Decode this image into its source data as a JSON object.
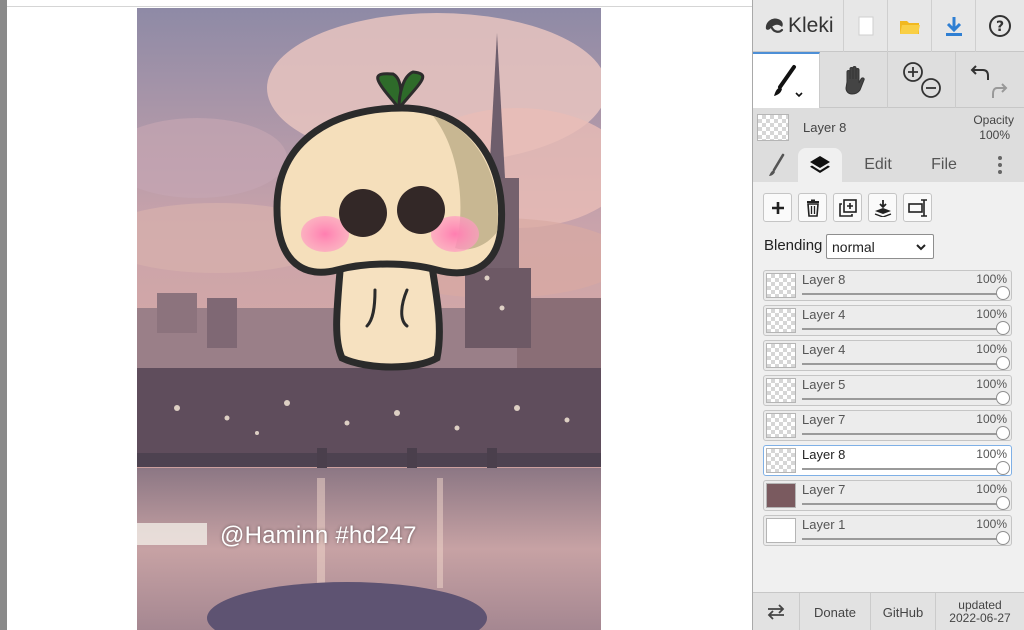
{
  "app": {
    "name": "Kleki",
    "accent": "#4d8fd6"
  },
  "canvas": {
    "watermark": "@Haminn  #hd247"
  },
  "topbar": {
    "buttons": [
      "new-image-icon",
      "open-folder-icon",
      "download-icon",
      "help-icon"
    ]
  },
  "tools": {
    "active": "brush",
    "items": [
      "brush-icon",
      "hand-icon",
      "zoom-in-icon",
      "zoom-out-icon",
      "undo-icon",
      "redo-icon"
    ]
  },
  "current_layer": {
    "name": "Layer 8",
    "opacity_label": "Opacity",
    "opacity_value": "100%"
  },
  "tabs": {
    "edit": "Edit",
    "file": "File",
    "active": "layers"
  },
  "layer_actions": [
    "add-layer",
    "delete-layer",
    "duplicate-layer",
    "merge-down",
    "rename-layer"
  ],
  "blending": {
    "label": "Blending",
    "value": "normal"
  },
  "layers": [
    {
      "name": "Layer 8",
      "opacity": "100%",
      "level": 1.0,
      "selected": false
    },
    {
      "name": "Layer 4",
      "opacity": "100%",
      "level": 1.0,
      "selected": false
    },
    {
      "name": "Layer 4",
      "opacity": "100%",
      "level": 1.0,
      "selected": false
    },
    {
      "name": "Layer 5",
      "opacity": "100%",
      "level": 1.0,
      "selected": false
    },
    {
      "name": "Layer 7",
      "opacity": "100%",
      "level": 1.0,
      "selected": false
    },
    {
      "name": "Layer 8",
      "opacity": "100%",
      "level": 1.0,
      "selected": true
    },
    {
      "name": "Layer 7",
      "opacity": "100%",
      "level": 1.0,
      "selected": false
    },
    {
      "name": "Layer 1",
      "opacity": "100%",
      "level": 1.0,
      "selected": false
    }
  ],
  "bottombar": {
    "donate": "Donate",
    "github": "GitHub",
    "updated_label": "updated",
    "updated_date": "2022-06-27"
  }
}
